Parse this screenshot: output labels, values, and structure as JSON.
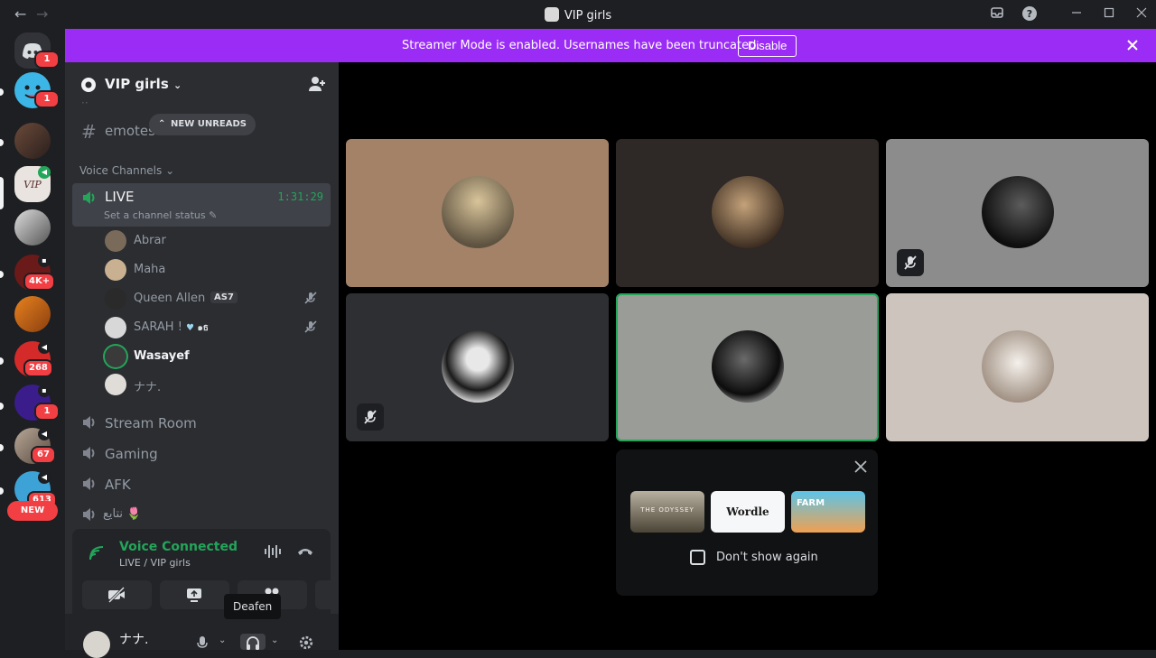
{
  "window": {
    "title": "VIP girls",
    "nav_back": "←",
    "nav_forward": "→"
  },
  "banner": {
    "text": "Streamer Mode is enabled. Usernames have been truncated.",
    "disable_label": "Disable"
  },
  "guilds": {
    "badges": [
      "1",
      "1",
      "4K+",
      "268",
      "1",
      "67",
      "613"
    ],
    "new_label": "NEW"
  },
  "server": {
    "name": "VIP girls",
    "new_unreads": "NEW UNREADS",
    "text_channel": "emotes",
    "voice_category": "Voice Channels",
    "live_channel": {
      "name": "LIVE",
      "timer": "1:31:29",
      "status_placeholder": "Set a channel status"
    },
    "members": [
      {
        "name": "Abrar",
        "tag": ""
      },
      {
        "name": "Maha",
        "tag": ""
      },
      {
        "name": "Queen Allen",
        "tag": "AS7"
      },
      {
        "name": "SARAH !",
        "tag": "๑ธ"
      },
      {
        "name": "Wasayef",
        "tag": ""
      },
      {
        "name": "ナナ.",
        "tag": ""
      }
    ],
    "voice_channels": [
      "Stream Room",
      "Gaming",
      "AFK",
      "نتايع 🌷"
    ]
  },
  "voice_panel": {
    "title": "Voice Connected",
    "subtitle": "LIVE / VIP girls"
  },
  "user": {
    "name": "ナナ.",
    "tooltip": "Deafen"
  },
  "activity": {
    "games": [
      "THE ODYSSEY",
      "Wordle",
      "FARM"
    ],
    "checkbox_label": "Don't show again"
  },
  "colors": {
    "accent_banner": "#9b2cf5",
    "voice_green": "#23a55a",
    "badge_red": "#f23f43"
  }
}
